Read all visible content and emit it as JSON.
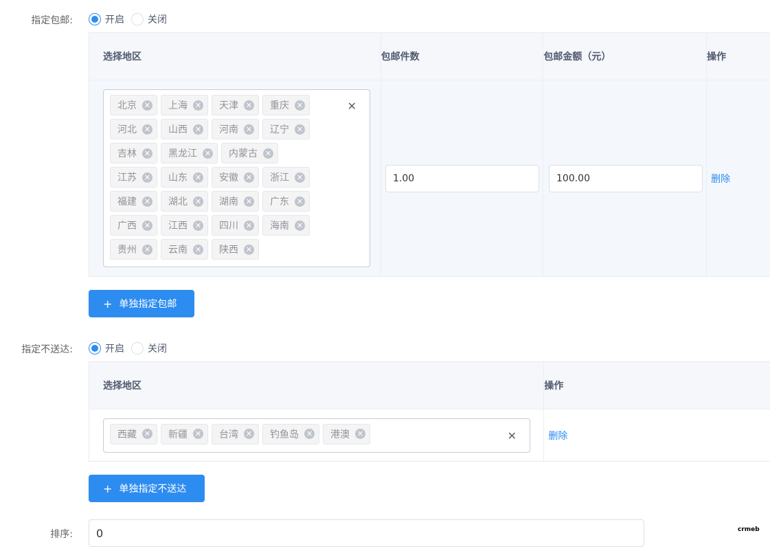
{
  "free_shipping": {
    "label": "指定包邮:",
    "radio_on": "开启",
    "radio_off": "关闭",
    "selected": "on",
    "columns": [
      "选择地区",
      "包邮件数",
      "包邮金额（元）",
      "操作"
    ],
    "row": {
      "regions": [
        "北京",
        "上海",
        "天津",
        "重庆",
        "河北",
        "山西",
        "河南",
        "辽宁",
        "吉林",
        "黑龙江",
        "内蒙古",
        "江苏",
        "山东",
        "安徽",
        "浙江",
        "福建",
        "湖北",
        "湖南",
        "广东",
        "广西",
        "江西",
        "四川",
        "海南",
        "贵州",
        "云南",
        "陕西"
      ],
      "count": "1.00",
      "amount": "100.00",
      "delete_label": "删除"
    },
    "add_button": "单独指定包邮"
  },
  "no_delivery": {
    "label": "指定不送达:",
    "radio_on": "开启",
    "radio_off": "关闭",
    "selected": "on",
    "columns": [
      "选择地区",
      "操作"
    ],
    "row": {
      "regions": [
        "西藏",
        "新疆",
        "台湾",
        "钓鱼岛",
        "港澳"
      ],
      "delete_label": "删除"
    },
    "add_button": "单独指定不送达"
  },
  "sort": {
    "label": "排序:",
    "value": "0"
  },
  "logo_text": "crmeb",
  "colors": {
    "primary": "#2d8cf0",
    "table_header_bg": "#f5f7fa",
    "highlight_row_bg": "#f4f7fc"
  },
  "icons": {
    "tag_close": "circle-x-icon",
    "clear": "close-icon",
    "add": "plus-icon"
  }
}
